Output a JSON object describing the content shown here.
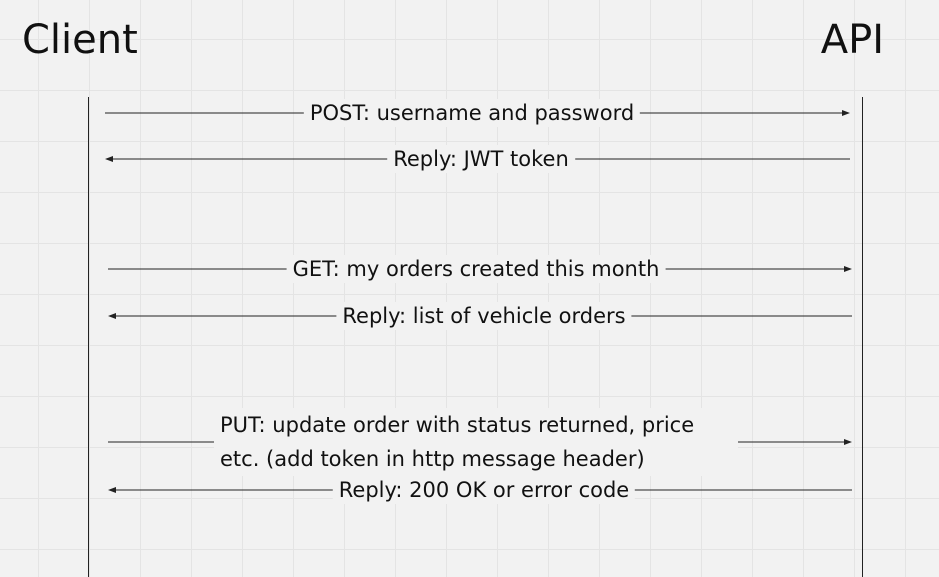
{
  "actors": {
    "client": "Client",
    "api": "API"
  },
  "messages": [
    {
      "direction": "right",
      "text": "POST: username and password"
    },
    {
      "direction": "left",
      "text": "Reply: JWT token"
    },
    {
      "direction": "right",
      "text": "GET: my orders created this month"
    },
    {
      "direction": "left",
      "text": "Reply: list of vehicle orders"
    },
    {
      "direction": "right",
      "text": "PUT: update order with status returned, price etc. (add token in http message header)"
    },
    {
      "direction": "left",
      "text": "Reply: 200 OK or error code"
    }
  ],
  "colors": {
    "background": "#f2f2f2",
    "grid": "#e4e4e4",
    "line": "#222222",
    "text": "#111111"
  }
}
